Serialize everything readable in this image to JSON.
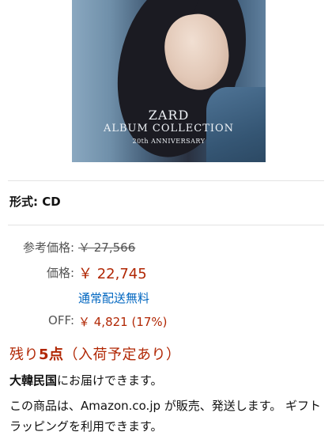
{
  "cover": {
    "title": "ZARD",
    "subtitle": "ALBUM COLLECTION",
    "small": "20th ANNIVERSARY"
  },
  "format": {
    "text": "形式: CD"
  },
  "pricing": {
    "reference_label": "参考価格:",
    "reference_value": "￥ 27,566",
    "price_label": "価格:",
    "price_value": "￥ 22,745",
    "shipping_text": "通常配送無料",
    "off_label": "OFF:",
    "off_value": "￥ 4,821 (17%)"
  },
  "stock": {
    "prefix": "残り",
    "count": "5点",
    "suffix": "（入荷予定あり）"
  },
  "delivery": {
    "country": "大韓民国",
    "text": "にお届けできます。"
  },
  "seller": {
    "text": "この商品は、Amazon.co.jp が販売、発送します。 ギフトラッピングを利用できます。"
  },
  "colors": {
    "price_red": "#B12704",
    "link_blue": "#0066c0"
  }
}
